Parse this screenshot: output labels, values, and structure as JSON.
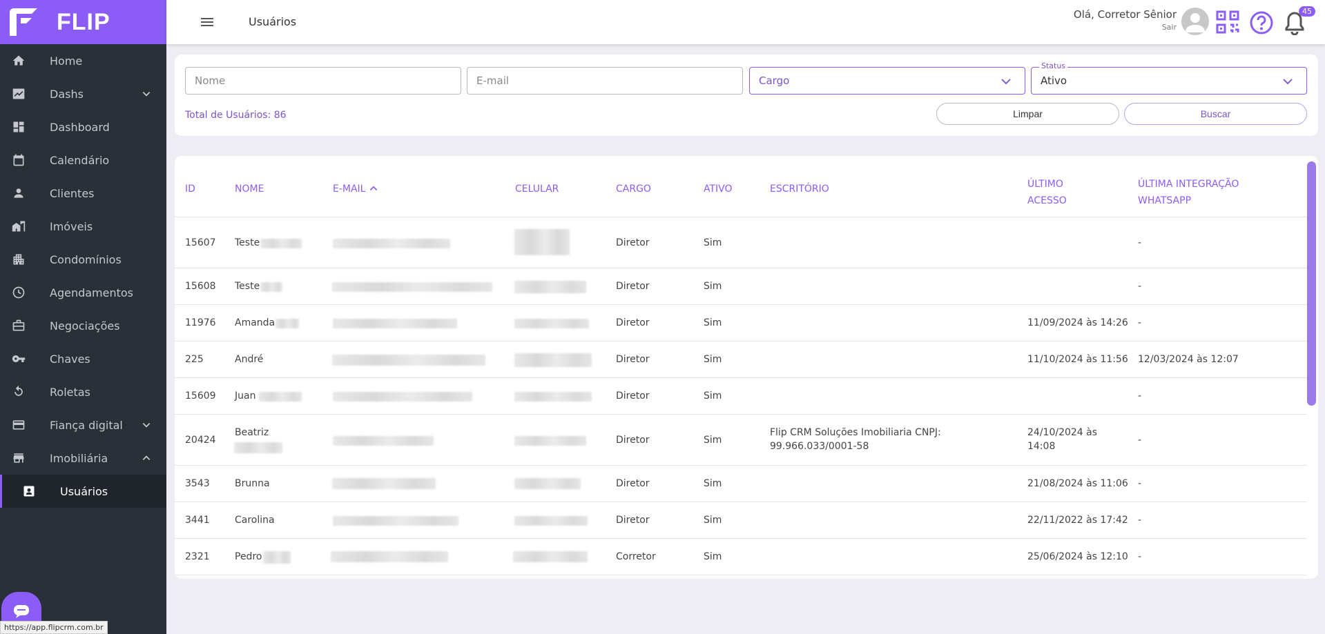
{
  "app": {
    "logo_text": "FLIP",
    "status_url": "https://app.flipcrm.com.br"
  },
  "header": {
    "title": "Usuários",
    "greeting": "Olá, Corretor Sênior",
    "logout": "Sair",
    "notification_count": "45"
  },
  "sidebar": {
    "items": [
      {
        "label": "Home",
        "icon": "home-icon"
      },
      {
        "label": "Dashs",
        "icon": "trending-up-icon",
        "expandable": true
      },
      {
        "label": "Dashboard",
        "icon": "dashboard-icon"
      },
      {
        "label": "Calendário",
        "icon": "calendar-icon"
      },
      {
        "label": "Clientes",
        "icon": "person-icon"
      },
      {
        "label": "Imóveis",
        "icon": "buildings-icon"
      },
      {
        "label": "Condomínios",
        "icon": "apartment-icon"
      },
      {
        "label": "Agendamentos",
        "icon": "clock-icon"
      },
      {
        "label": "Negociações",
        "icon": "briefcase-icon"
      },
      {
        "label": "Chaves",
        "icon": "key-icon"
      },
      {
        "label": "Roletas",
        "icon": "rotate-icon"
      },
      {
        "label": "Fiança digital",
        "icon": "credit-card-icon",
        "expandable": true
      },
      {
        "label": "Imobiliária",
        "icon": "store-icon",
        "expanded": true
      },
      {
        "label": "Usuários",
        "icon": "user-card-icon",
        "active": true
      }
    ]
  },
  "filters": {
    "name_placeholder": "Nome",
    "email_placeholder": "E-mail",
    "cargo_placeholder": "Cargo",
    "status_label": "Status",
    "status_value": "Ativo",
    "total_label": "Total de Usuários: 86",
    "clear_label": "Limpar",
    "search_label": "Buscar"
  },
  "table": {
    "headers": {
      "id": "ID",
      "nome": "NOME",
      "email": "E-MAIL",
      "celular": "CELULAR",
      "cargo": "CARGO",
      "ativo": "ATIVO",
      "escritorio": "ESCRITÓRIO",
      "ultimo_acesso_1": "ÚLTIMO",
      "ultimo_acesso_2": "ACESSO",
      "whatsapp_1": "ÚLTIMA INTEGRAÇÃO",
      "whatsapp_2": "WHATSAPP"
    },
    "rows": [
      {
        "id": "15607",
        "nome": "Teste",
        "cargo": "Diretor",
        "ativo": "Sim",
        "escritorio": "",
        "ultimo_acesso": "",
        "whatsapp": "-"
      },
      {
        "id": "15608",
        "nome": "Teste",
        "cargo": "Diretor",
        "ativo": "Sim",
        "escritorio": "",
        "ultimo_acesso": "",
        "whatsapp": "-"
      },
      {
        "id": "11976",
        "nome": "Amanda",
        "cargo": "Diretor",
        "ativo": "Sim",
        "escritorio": "",
        "ultimo_acesso": "11/09/2024 às 14:26",
        "whatsapp": "-"
      },
      {
        "id": "225",
        "nome": "André",
        "cargo": "Diretor",
        "ativo": "Sim",
        "escritorio": "",
        "ultimo_acesso": "11/10/2024 às 11:56",
        "whatsapp": "12/03/2024 às 12:07"
      },
      {
        "id": "15609",
        "nome": "Juan",
        "cargo": "Diretor",
        "ativo": "Sim",
        "escritorio": "",
        "ultimo_acesso": "",
        "whatsapp": "-"
      },
      {
        "id": "20424",
        "nome": "Beatriz",
        "cargo": "Diretor",
        "ativo": "Sim",
        "escritorio": "Flip CRM Soluções Imobiliaria CNPJ: 99.966.033/0001-58",
        "ultimo_acesso": "24/10/2024 às 14:08",
        "whatsapp": "-"
      },
      {
        "id": "3543",
        "nome": "Brunna",
        "cargo": "Diretor",
        "ativo": "Sim",
        "escritorio": "",
        "ultimo_acesso": "21/08/2024 às 11:06",
        "whatsapp": "-"
      },
      {
        "id": "3441",
        "nome": "Carolina",
        "cargo": "Diretor",
        "ativo": "Sim",
        "escritorio": "",
        "ultimo_acesso": "22/11/2022 às 17:42",
        "whatsapp": "-"
      },
      {
        "id": "2321",
        "nome": "Pedro",
        "cargo": "Corretor",
        "ativo": "Sim",
        "escritorio": "",
        "ultimo_acesso": "25/06/2024 às 12:10",
        "whatsapp": "-"
      }
    ]
  },
  "colors": {
    "accent": "#8b5cf6",
    "sidebar_bg": "#293038",
    "page_bg": "#eeedf3"
  }
}
